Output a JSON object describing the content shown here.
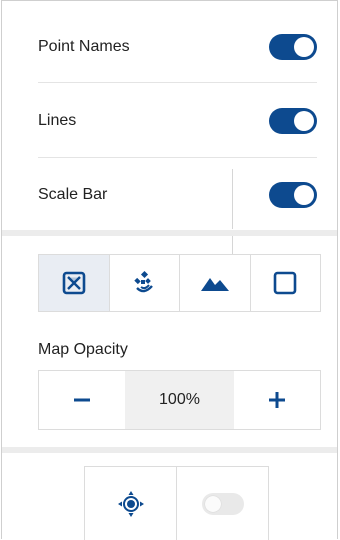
{
  "layers": [
    {
      "label": "Point Names",
      "on": true
    },
    {
      "label": "Lines",
      "on": true
    },
    {
      "label": "Scale Bar",
      "on": true
    }
  ],
  "map_types": [
    {
      "icon": "satellite-box-icon",
      "selected": true
    },
    {
      "icon": "satellite-dish-icon",
      "selected": false
    },
    {
      "icon": "terrain-icon",
      "selected": false
    },
    {
      "icon": "blank-map-icon",
      "selected": false
    }
  ],
  "opacity": {
    "title": "Map Opacity",
    "value": "100%",
    "decrease_icon": "minus-icon",
    "increase_icon": "plus-icon"
  },
  "bottom": {
    "center_icon": "gps-center-icon",
    "toggle_on": false
  },
  "colors": {
    "accent": "#0d4a8f",
    "selected_bg": "#e9edf3",
    "divider": "#ececec"
  }
}
